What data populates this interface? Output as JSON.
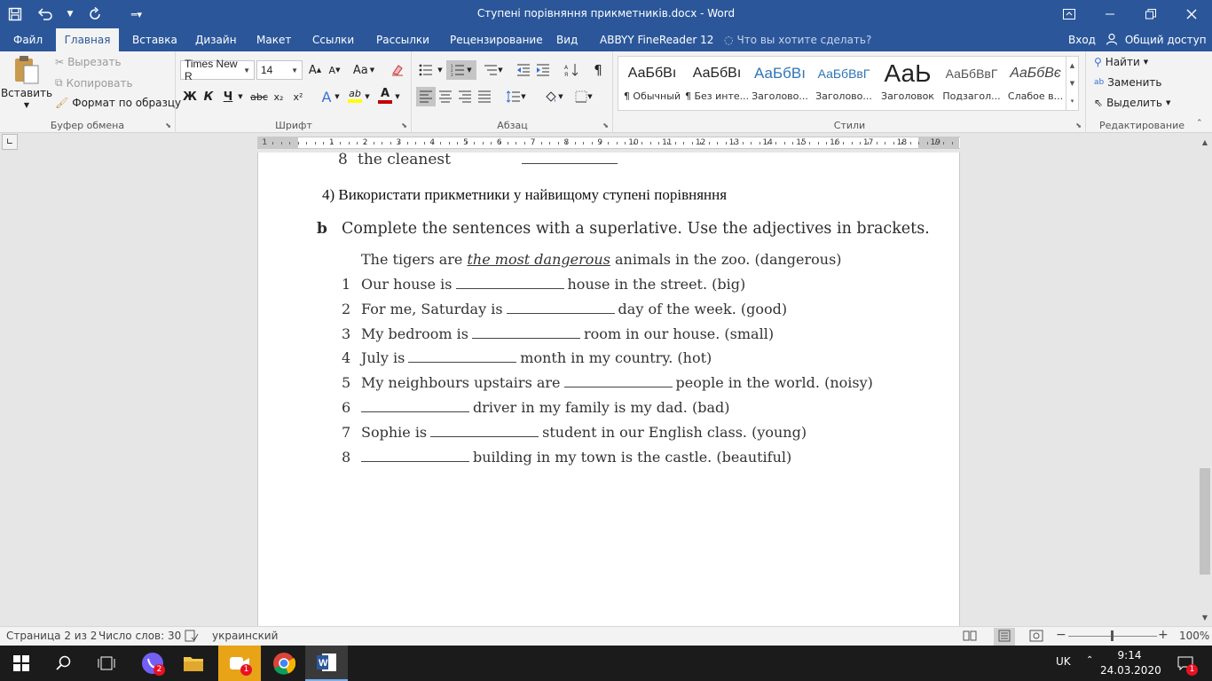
{
  "window": {
    "title": "Ступені порівняння прикметників.docx - Word",
    "qat": [
      "save-icon",
      "undo-icon",
      "redo-icon",
      "customize-icon"
    ],
    "controls": [
      "ribbon-display-icon",
      "minimize-icon",
      "restore-icon",
      "close-icon"
    ]
  },
  "tabs": [
    "Файл",
    "Главная",
    "Вставка",
    "Дизайн",
    "Макет",
    "Ссылки",
    "Рассылки",
    "Рецензирование",
    "Вид",
    "ABBYY FineReader 12"
  ],
  "active_tab": "Главная",
  "tell_me": "Что вы хотите сделать?",
  "login": "Вход",
  "share": "Общий доступ",
  "clipboard": {
    "paste": "Вставить",
    "cut": "Вырезать",
    "copy": "Копировать",
    "format_painter": "Формат по образцу",
    "label": "Буфер обмена"
  },
  "font": {
    "name": "Times New R",
    "size": "14",
    "bold": "Ж",
    "italic": "К",
    "underline": "Ч",
    "strike": "abc",
    "sub": "x₂",
    "sup": "x²",
    "label": "Шрифт",
    "aa": "Aa",
    "grow": "A",
    "shrink": "A",
    "text_effect": "A",
    "highlight": "ab",
    "font_color": "A",
    "highlight_color": "#ffff00",
    "font_color_value": "#c00000"
  },
  "paragraph": {
    "label": "Абзац"
  },
  "styles": {
    "label": "Стили",
    "items": [
      {
        "sample": "АаБбВı",
        "name": "¶ Обычный"
      },
      {
        "sample": "АаБбВı",
        "name": "¶ Без инте..."
      },
      {
        "sample": "АаБбВı",
        "name": "Заголово..."
      },
      {
        "sample": "АаБбВвГ",
        "name": "Заголово..."
      },
      {
        "sample": "АаЬ",
        "name": "Заголовок"
      },
      {
        "sample": "АаБбВвГ",
        "name": "Подзагол..."
      },
      {
        "sample": "АаБбВє",
        "name": "Слабое в..."
      }
    ]
  },
  "editing": {
    "label": "Редактирование",
    "find": "Найти",
    "replace": "Заменить",
    "select": "Выделить"
  },
  "ruler": {
    "numbers": [
      "1",
      "1",
      "2",
      "3",
      "4",
      "5",
      "6",
      "7",
      "8",
      "9",
      "10",
      "11",
      "12",
      "13",
      "14",
      "15",
      "16",
      "17",
      "18",
      "19"
    ]
  },
  "document": {
    "prev_item": {
      "num": "8",
      "text": "the cleanest"
    },
    "heading4": "4)  Використати прикметники у найвищому ступені порівняння",
    "task_b_label": "b",
    "task_b": "Complete the sentences with a superlative. Use the adjectives in brackets.",
    "example": {
      "before": "The tigers are ",
      "emph": "the most dangerous",
      "after": " animals in the zoo.  (dangerous)"
    },
    "sentences": [
      {
        "num": "1",
        "before": "Our house is",
        "after": "house in the street.  (big)"
      },
      {
        "num": "2",
        "before": "For me, Saturday is",
        "after": "day of the week.  (good)"
      },
      {
        "num": "3",
        "before": "My bedroom is",
        "after": "room in our house.  (small)"
      },
      {
        "num": "4",
        "before": "July is",
        "after": "month in my country.  (hot)"
      },
      {
        "num": "5",
        "before": "My neighbours upstairs are",
        "after": "people in the world.  (noisy)"
      },
      {
        "num": "6",
        "before": "",
        "after": "driver in my family is my dad.  (bad)"
      },
      {
        "num": "7",
        "before": "Sophie is",
        "after": "student in our English class.  (young)"
      },
      {
        "num": "8",
        "before": "",
        "after": "building in my town is the castle.  (beautiful)"
      }
    ]
  },
  "status": {
    "page": "Страница 2 из 2",
    "words": "Число слов: 30",
    "language": "украинский",
    "zoom": "100%",
    "zoom_minus": "−",
    "zoom_plus": "+"
  },
  "taskbar": {
    "apps": [
      {
        "name": "start-icon"
      },
      {
        "name": "search-icon"
      },
      {
        "name": "task-view-icon"
      },
      {
        "name": "viber-icon",
        "badge": "2"
      },
      {
        "name": "file-explorer-icon"
      },
      {
        "name": "video-icon",
        "badge": "1"
      },
      {
        "name": "chrome-icon"
      },
      {
        "name": "word-icon"
      }
    ],
    "lang": "UK",
    "time": "9:14",
    "date": "24.03.2020",
    "notifications": "1"
  }
}
